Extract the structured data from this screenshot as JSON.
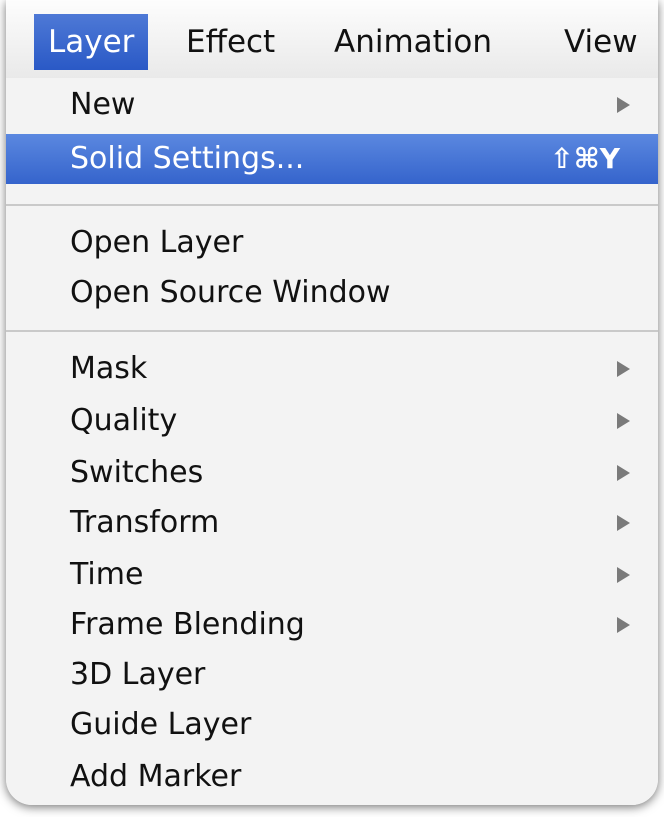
{
  "menubar": {
    "items": [
      {
        "label": "Layer",
        "active": true
      },
      {
        "label": "Effect",
        "active": false
      },
      {
        "label": "Animation",
        "active": false
      },
      {
        "label": "View",
        "active": false
      }
    ]
  },
  "menu": {
    "items": [
      {
        "label": "New",
        "submenu": true
      },
      {
        "label": "Solid Settings...",
        "shortcut": "⇧⌘Y",
        "highlighted": true
      },
      {
        "label": "Open Layer"
      },
      {
        "label": "Open Source Window"
      },
      {
        "label": "Mask",
        "submenu": true
      },
      {
        "label": "Quality",
        "submenu": true
      },
      {
        "label": "Switches",
        "submenu": true
      },
      {
        "label": "Transform",
        "submenu": true
      },
      {
        "label": "Time",
        "submenu": true
      },
      {
        "label": "Frame Blending",
        "submenu": true
      },
      {
        "label": "3D Layer"
      },
      {
        "label": "Guide Layer"
      },
      {
        "label": "Add Marker"
      }
    ]
  },
  "colors": {
    "highlight": "#3a68cf",
    "menu_background": "#f3f3f3",
    "submenu_arrow": "#7a7a7a"
  }
}
